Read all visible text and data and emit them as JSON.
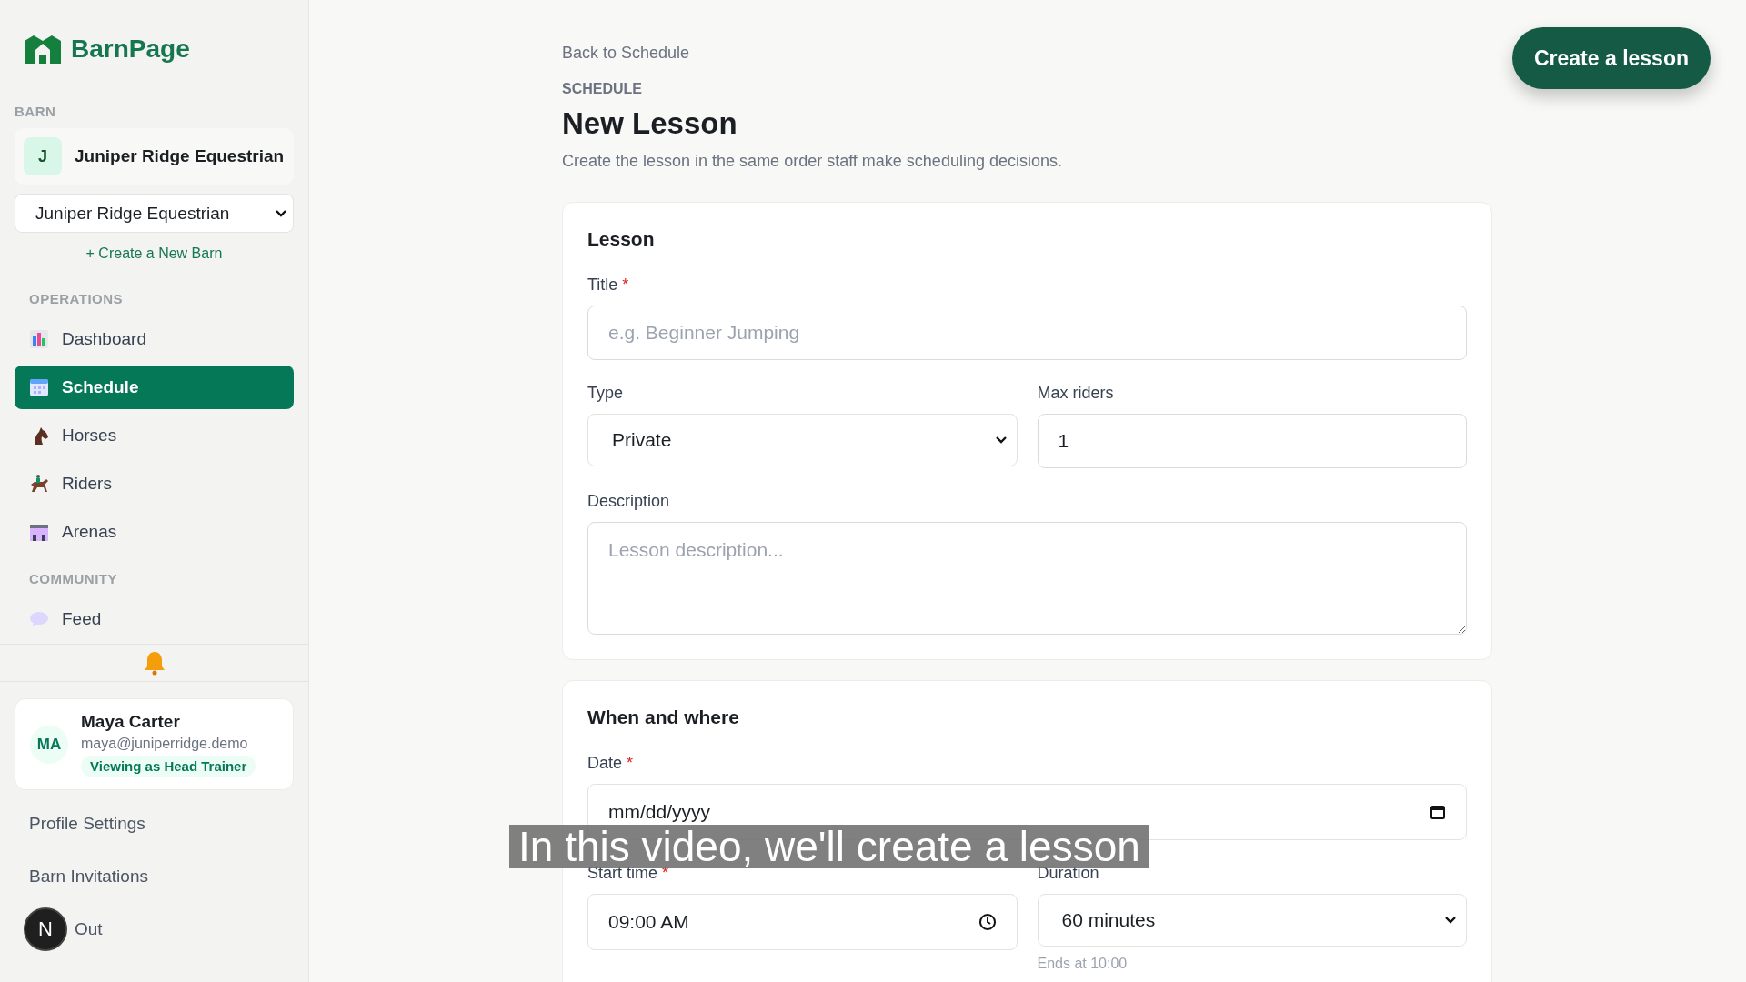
{
  "brand": {
    "name": "BarnPage"
  },
  "sidebar": {
    "barn_label": "BARN",
    "barn": {
      "initial": "J",
      "name": "Juniper Ridge Equestrian"
    },
    "barn_select": {
      "value": "Juniper Ridge Equestrian"
    },
    "create_barn_link": "+ Create a New Barn",
    "sections": [
      {
        "heading": "OPERATIONS",
        "items": [
          {
            "label": "Dashboard",
            "selected": false
          },
          {
            "label": "Schedule",
            "selected": true
          },
          {
            "label": "Horses",
            "selected": false
          },
          {
            "label": "Riders",
            "selected": false
          },
          {
            "label": "Arenas",
            "selected": false
          }
        ]
      },
      {
        "heading": "COMMUNITY",
        "items": [
          {
            "label": "Feed",
            "selected": false
          }
        ]
      }
    ],
    "user": {
      "initials": "MA",
      "name": "Maya Carter",
      "email": "maya@juniperridge.demo",
      "role_badge": "Viewing as Head Trainer"
    },
    "links": [
      "Profile Settings",
      "Barn Invitations",
      "Out"
    ]
  },
  "dev_badge": "N",
  "header": {
    "back_link": "Back to Schedule",
    "eyebrow": "SCHEDULE",
    "title": "New Lesson",
    "subtitle": "Create the lesson in the same order staff make scheduling decisions."
  },
  "primary_button": "Create a lesson",
  "form_sections": [
    {
      "title": "Lesson",
      "rows": [
        [
          {
            "kind": "text",
            "label": "Title",
            "mark": "*",
            "placeholder": "e.g. Beginner Jumping"
          }
        ],
        [
          {
            "kind": "select",
            "label": "Type",
            "value": "Private"
          },
          {
            "kind": "number",
            "label": "Max riders",
            "value": "1"
          }
        ],
        [
          {
            "kind": "textarea",
            "label": "Description",
            "placeholder": "Lesson description..."
          }
        ]
      ]
    },
    {
      "title": "When and where",
      "rows": [
        [
          {
            "kind": "date",
            "label": "Date",
            "mark": "*",
            "value": "mm/dd/yyyy"
          }
        ],
        [
          {
            "kind": "time",
            "label": "Start time",
            "mark": "*",
            "value": "09:00 AM"
          },
          {
            "kind": "select",
            "label": "Duration",
            "value": "60 minutes",
            "hint": "Ends at 10:00"
          }
        ]
      ]
    }
  ],
  "caption": "In this video, we'll create a lesson"
}
